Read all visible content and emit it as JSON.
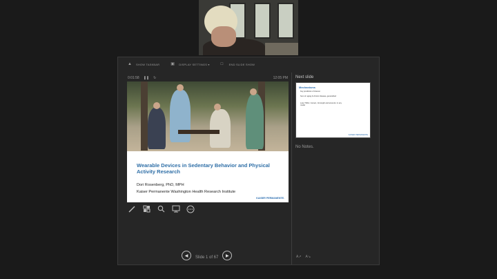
{
  "toolbar": {
    "show_taskbar": "SHOW TASKBAR",
    "display_settings": "DISPLAY SETTINGS ▾",
    "end_slide_show": "END SLIDE SHOW"
  },
  "timer": {
    "elapsed": "0:01:58",
    "clock": "12:05 PM"
  },
  "current_slide": {
    "title": "Wearable Devices in Sedentary Behavior and Physical Activity Research",
    "author": "Dori Rosenberg, PhD, MPH",
    "organization": "Kaiser Permanente Washington Health Research Institute",
    "logo": "KAISER PERMANENTE."
  },
  "navigation": {
    "slide_counter": "Slide 1 of 67"
  },
  "next_slide": {
    "label": "Next slide",
    "title": "Mechanisms",
    "bullets": [
      "Key predictors of interest",
      "Sum of: aging & chronic disease, generalized",
      "Lose TRAC, Gomez, Jot length and amounts: in any model"
    ],
    "logo": "KAISER PERMANENTE"
  },
  "notes": {
    "text": "No Notes."
  },
  "colors": {
    "background": "#1a1a1a",
    "window": "#262626",
    "slide_title_blue": "#2f6fa7"
  }
}
